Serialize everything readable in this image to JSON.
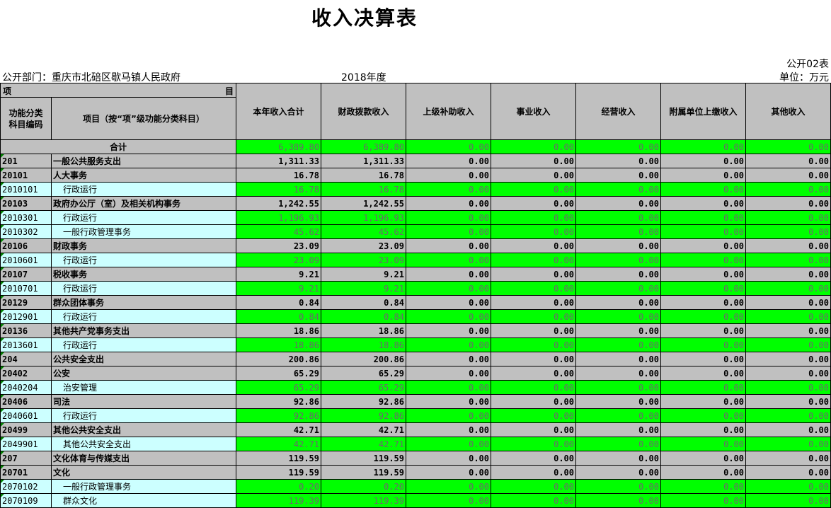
{
  "title": "收入决算表",
  "form_no": "公开02表",
  "dept": "公开部门：重庆市北碚区歇马镇人民政府",
  "year": "2018年度",
  "unit": "单位：万元",
  "header": {
    "xiang": "项",
    "mu": "目",
    "code_col": "功能分类\n科目编码",
    "name_col": "项目（按“项”级功能分类科目）",
    "cols": [
      "本年收入合计",
      "财政拨款收入",
      "上级补助收入",
      "事业收入",
      "经营收入",
      "附属单位上缴收入",
      "其他收入"
    ]
  },
  "total": {
    "label": "合计",
    "values": [
      "6,389.80",
      "6,389.80",
      "0.00",
      "0.00",
      "0.00",
      "0.00",
      "0.00"
    ]
  },
  "rows": [
    {
      "code": "201",
      "name": "一般公共服务支出",
      "level": "group",
      "values": [
        "1,311.33",
        "1,311.33",
        "0.00",
        "0.00",
        "0.00",
        "0.00",
        "0.00"
      ]
    },
    {
      "code": "20101",
      "name": "人大事务",
      "level": "group",
      "values": [
        "16.78",
        "16.78",
        "0.00",
        "0.00",
        "0.00",
        "0.00",
        "0.00"
      ]
    },
    {
      "code": "2010101",
      "name": "行政运行",
      "level": "item",
      "values": [
        "16.78",
        "16.78",
        "0.00",
        "0.00",
        "0.00",
        "0.00",
        "0.00"
      ]
    },
    {
      "code": "20103",
      "name": "政府办公厅（室）及相关机构事务",
      "level": "group",
      "values": [
        "1,242.55",
        "1,242.55",
        "0.00",
        "0.00",
        "0.00",
        "0.00",
        "0.00"
      ]
    },
    {
      "code": "2010301",
      "name": "行政运行",
      "level": "item",
      "values": [
        "1,196.93",
        "1,196.93",
        "0.00",
        "0.00",
        "0.00",
        "0.00",
        "0.00"
      ]
    },
    {
      "code": "2010302",
      "name": "一般行政管理事务",
      "level": "item",
      "values": [
        "45.62",
        "45.62",
        "0.00",
        "0.00",
        "0.00",
        "0.00",
        "0.00"
      ]
    },
    {
      "code": "20106",
      "name": "财政事务",
      "level": "group",
      "values": [
        "23.09",
        "23.09",
        "0.00",
        "0.00",
        "0.00",
        "0.00",
        "0.00"
      ]
    },
    {
      "code": "2010601",
      "name": "行政运行",
      "level": "item",
      "values": [
        "23.09",
        "23.09",
        "0.00",
        "0.00",
        "0.00",
        "0.00",
        "0.00"
      ]
    },
    {
      "code": "20107",
      "name": "税收事务",
      "level": "group",
      "values": [
        "9.21",
        "9.21",
        "0.00",
        "0.00",
        "0.00",
        "0.00",
        "0.00"
      ]
    },
    {
      "code": "2010701",
      "name": "行政运行",
      "level": "item",
      "values": [
        "9.21",
        "9.21",
        "0.00",
        "0.00",
        "0.00",
        "0.00",
        "0.00"
      ]
    },
    {
      "code": "20129",
      "name": "群众团体事务",
      "level": "group",
      "values": [
        "0.84",
        "0.84",
        "0.00",
        "0.00",
        "0.00",
        "0.00",
        "0.00"
      ]
    },
    {
      "code": "2012901",
      "name": "行政运行",
      "level": "item",
      "values": [
        "0.84",
        "0.84",
        "0.00",
        "0.00",
        "0.00",
        "0.00",
        "0.00"
      ]
    },
    {
      "code": "20136",
      "name": "其他共产党事务支出",
      "level": "group",
      "values": [
        "18.86",
        "18.86",
        "0.00",
        "0.00",
        "0.00",
        "0.00",
        "0.00"
      ]
    },
    {
      "code": "2013601",
      "name": "行政运行",
      "level": "item",
      "values": [
        "18.86",
        "18.86",
        "0.00",
        "0.00",
        "0.00",
        "0.00",
        "0.00"
      ]
    },
    {
      "code": "204",
      "name": "公共安全支出",
      "level": "group",
      "values": [
        "200.86",
        "200.86",
        "0.00",
        "0.00",
        "0.00",
        "0.00",
        "0.00"
      ]
    },
    {
      "code": "20402",
      "name": "公安",
      "level": "group",
      "values": [
        "65.29",
        "65.29",
        "0.00",
        "0.00",
        "0.00",
        "0.00",
        "0.00"
      ]
    },
    {
      "code": "2040204",
      "name": "治安管理",
      "level": "item",
      "values": [
        "65.29",
        "65.29",
        "0.00",
        "0.00",
        "0.00",
        "0.00",
        "0.00"
      ]
    },
    {
      "code": "20406",
      "name": "司法",
      "level": "group",
      "values": [
        "92.86",
        "92.86",
        "0.00",
        "0.00",
        "0.00",
        "0.00",
        "0.00"
      ]
    },
    {
      "code": "2040601",
      "name": "行政运行",
      "level": "item",
      "values": [
        "92.86",
        "92.86",
        "0.00",
        "0.00",
        "0.00",
        "0.00",
        "0.00"
      ]
    },
    {
      "code": "20499",
      "name": "其他公共安全支出",
      "level": "group",
      "values": [
        "42.71",
        "42.71",
        "0.00",
        "0.00",
        "0.00",
        "0.00",
        "0.00"
      ]
    },
    {
      "code": "2049901",
      "name": "其他公共安全支出",
      "level": "item",
      "values": [
        "42.71",
        "42.71",
        "0.00",
        "0.00",
        "0.00",
        "0.00",
        "0.00"
      ]
    },
    {
      "code": "207",
      "name": "文化体育与传媒支出",
      "level": "group",
      "values": [
        "119.59",
        "119.59",
        "0.00",
        "0.00",
        "0.00",
        "0.00",
        "0.00"
      ]
    },
    {
      "code": "20701",
      "name": "文化",
      "level": "group",
      "values": [
        "119.59",
        "119.59",
        "0.00",
        "0.00",
        "0.00",
        "0.00",
        "0.00"
      ]
    },
    {
      "code": "2070102",
      "name": "一般行政管理事务",
      "level": "item",
      "values": [
        "0.20",
        "0.20",
        "0.00",
        "0.00",
        "0.00",
        "0.00",
        "0.00"
      ]
    },
    {
      "code": "2070109",
      "name": "群众文化",
      "level": "item",
      "values": [
        "119.39",
        "119.39",
        "0.00",
        "0.00",
        "0.00",
        "0.00",
        "0.00"
      ]
    }
  ],
  "colors": {
    "header_grey": "#c0c0c0",
    "value_green": "#00ff00",
    "item_cyan": "#ccffff"
  }
}
